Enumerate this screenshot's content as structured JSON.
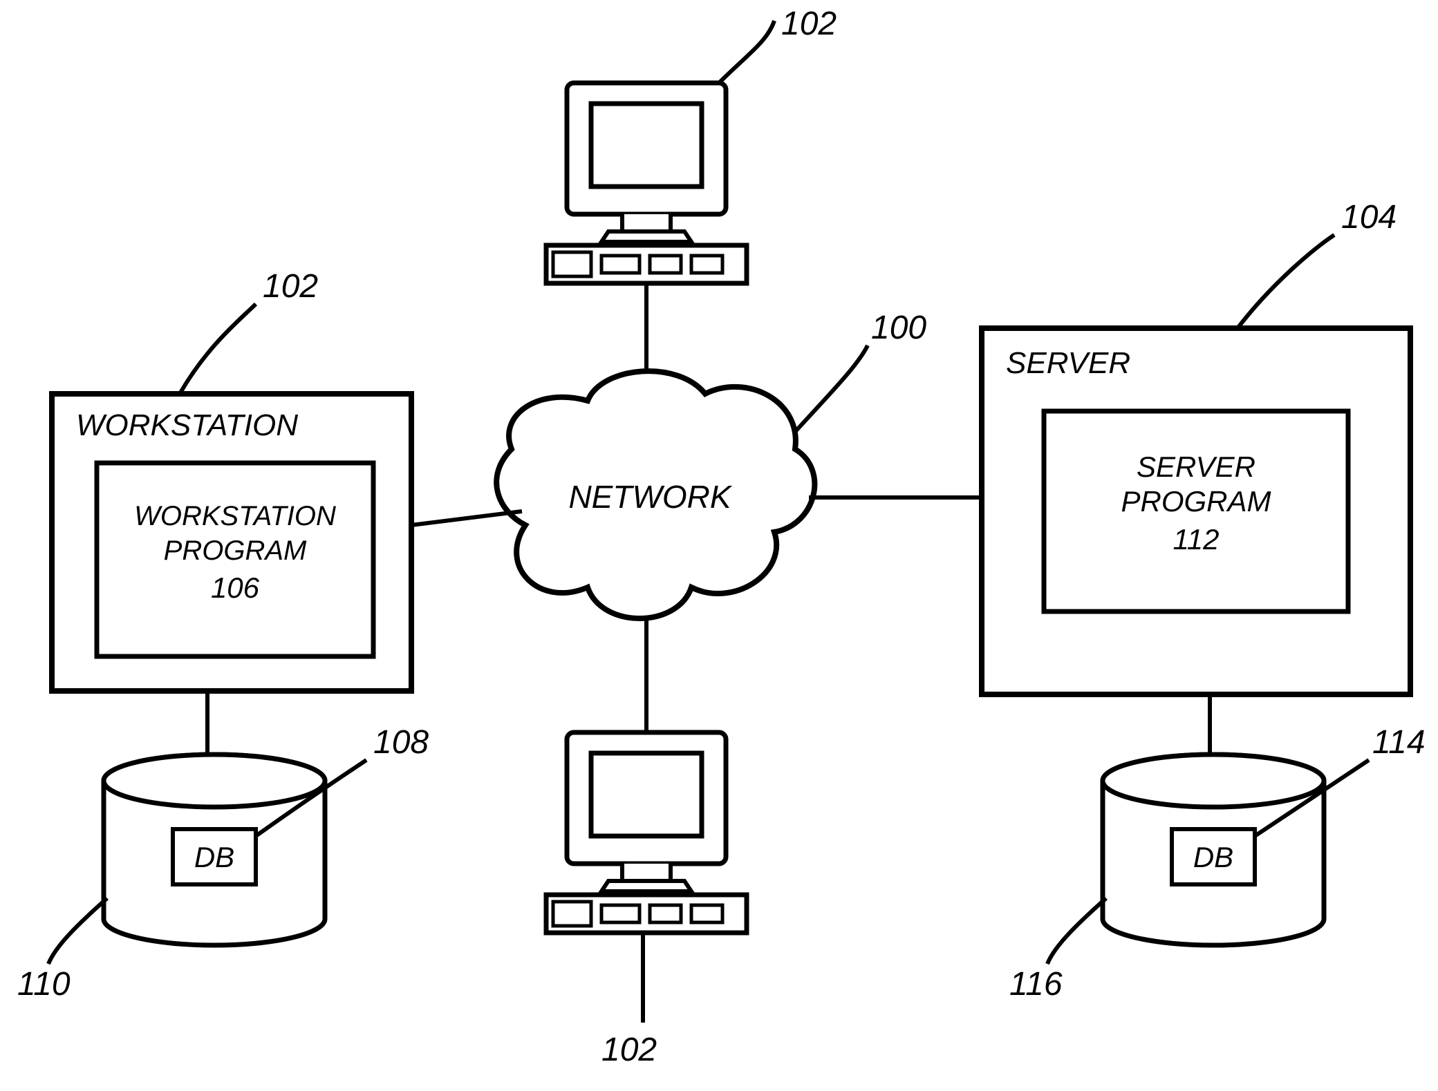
{
  "diagram": {
    "callouts": {
      "network": "100",
      "workstation_top": "102",
      "workstation_left": "102",
      "workstation_bottom": "102",
      "server": "104",
      "workstation_program": "106",
      "workstation_db_label": "108",
      "workstation_db_cyl": "110",
      "server_program": "112",
      "server_db_label": "114",
      "server_db_cyl": "116"
    },
    "labels": {
      "workstation_title": "WORKSTATION",
      "workstation_program_title": "WORKSTATION",
      "workstation_program_word": "PROGRAM",
      "server_title": "SERVER",
      "server_program_title": "SERVER",
      "server_program_word": "PROGRAM",
      "network": "NETWORK",
      "db": "DB"
    },
    "ref_numbers_font_size": 42,
    "label_font_size": 40
  }
}
